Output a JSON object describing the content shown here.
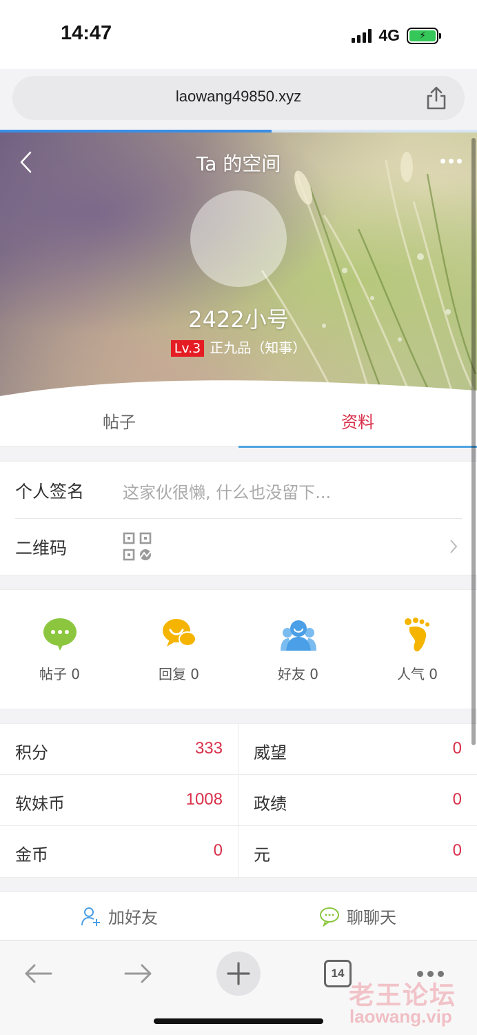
{
  "status_bar": {
    "time": "14:47",
    "network": "4G"
  },
  "browser": {
    "url": "laowang49850.xyz",
    "tab_count": "14",
    "load_progress": 0.57
  },
  "header": {
    "title": "Ta 的空间",
    "username": "2422小号",
    "level": "Lv.3",
    "rank": "正九品（知事）"
  },
  "tabs": [
    {
      "label": "帖子"
    },
    {
      "label": "资料",
      "active": true
    }
  ],
  "profile": {
    "signature_label": "个人签名",
    "signature_value": "这家伙很懒, 什么也没留下...",
    "qrcode_label": "二维码"
  },
  "stats": [
    {
      "label": "帖子 0",
      "icon": "chat-bubble-icon",
      "color": "#8cc63f"
    },
    {
      "label": "回复 0",
      "icon": "reply-icon",
      "color": "#f5b400"
    },
    {
      "label": "好友 0",
      "icon": "friends-icon",
      "color": "#4a9fe6"
    },
    {
      "label": "人气 0",
      "icon": "footprint-icon",
      "color": "#f5b400"
    }
  ],
  "credits": [
    {
      "label": "积分",
      "value": "333"
    },
    {
      "label": "威望",
      "value": "0"
    },
    {
      "label": "软妹币",
      "value": "1008"
    },
    {
      "label": "政绩",
      "value": "0"
    },
    {
      "label": "金币",
      "value": "0"
    },
    {
      "label": "元",
      "value": "0"
    }
  ],
  "actions": {
    "add_friend": "加好友",
    "chat": "聊聊天"
  },
  "watermark": {
    "cn": "老王论坛",
    "en": "laowang.vip"
  },
  "colors": {
    "accent_red": "#d9304a",
    "accent_blue": "#4da3e0"
  }
}
